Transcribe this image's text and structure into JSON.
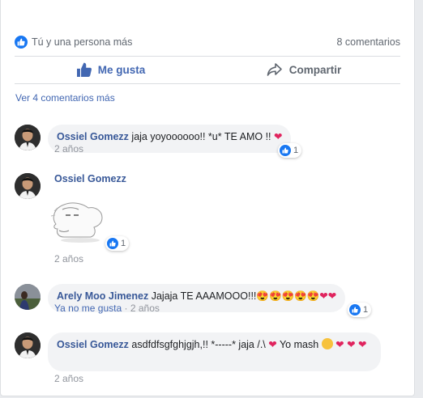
{
  "post": {
    "likes_summary": "Tú y una persona más",
    "comments_count": "8 comentarios",
    "like_label": "Me gusta",
    "share_label": "Compartir",
    "view_more": "Ver 4 comentarios más"
  },
  "comments": [
    {
      "author": "Ossiel Gomezz",
      "text": "jaja yoyoooooo!! *u* TE AMO !! ",
      "time": "2 años",
      "reactions": "1"
    },
    {
      "author": "Ossiel Gomezz",
      "text": "",
      "time": "2 años",
      "reactions": "1"
    },
    {
      "author": "Arely Moo Jimenez",
      "text": "Jajaja TE AAAMOOO!!!",
      "time": "2 años",
      "unlike_label": "Ya no me gusta",
      "separator": "·",
      "reactions": "1"
    },
    {
      "author": "Ossiel Gomezz",
      "text": "asdfdfsgfghjgjh,!! *-----* jaja /.\\ ",
      "text_b": " Yo mash ",
      "time": "2 años"
    }
  ],
  "colors": {
    "accent": "#4267b2",
    "name": "#385898",
    "heart": "#e0245e",
    "facebook_blue": "#1877f2"
  }
}
